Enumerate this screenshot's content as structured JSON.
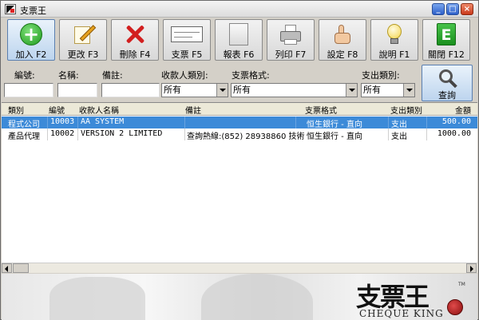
{
  "window": {
    "title": "支票王",
    "controls": [
      "_",
      "□",
      "×"
    ]
  },
  "toolbar": [
    {
      "label": "加入 F2",
      "icon": "add-icon"
    },
    {
      "label": "更改 F3",
      "icon": "pencil-icon"
    },
    {
      "label": "刪除 F4",
      "icon": "delete-icon"
    },
    {
      "label": "支票 F5",
      "icon": "cheque-icon"
    },
    {
      "label": "報表 F6",
      "icon": "report-icon"
    },
    {
      "label": "列印 F7",
      "icon": "printer-icon"
    },
    {
      "label": "設定 F8",
      "icon": "thumbs-up-icon"
    },
    {
      "label": "說明 F1",
      "icon": "lightbulb-icon"
    },
    {
      "label": "關閉 F12",
      "icon": "exit-icon"
    }
  ],
  "filters": {
    "code_label": "編號:",
    "code_value": "",
    "name_label": "名稱:",
    "name_value": "",
    "remark_label": "備註:",
    "remark_value": "",
    "payee_type_label": "收款人類別:",
    "payee_type_value": "所有",
    "cheque_format_label": "支票格式:",
    "cheque_format_value": "所有",
    "expense_type_label": "支出類別:",
    "expense_type_value": "所有",
    "search_label": "查詢"
  },
  "table": {
    "columns": [
      "類別",
      "編號",
      "收款人名稱",
      "備註",
      "支票格式",
      "支出類別",
      "金額"
    ],
    "rows": [
      {
        "category": "程式公司",
        "code": "10003",
        "payee": "AA SYSTEM",
        "remark": "",
        "format": "恒生銀行 - 直向",
        "expense": "支出",
        "amount": "500.00",
        "selected": true
      },
      {
        "category": "產品代理",
        "code": "10002",
        "payee": "VERSION 2 LIMITED",
        "remark": "查詢熱線:(852) 28938860  技術",
        "format": "恒生銀行 - 直向",
        "expense": "支出",
        "amount": "1000.00",
        "selected": false
      }
    ]
  },
  "brand": {
    "name_cn": "支票王",
    "name_en": "CHEQUE KING",
    "trademark": "TM"
  },
  "colors": {
    "selection": "#3c8ad8",
    "window_bg": "#d4d0c8"
  }
}
